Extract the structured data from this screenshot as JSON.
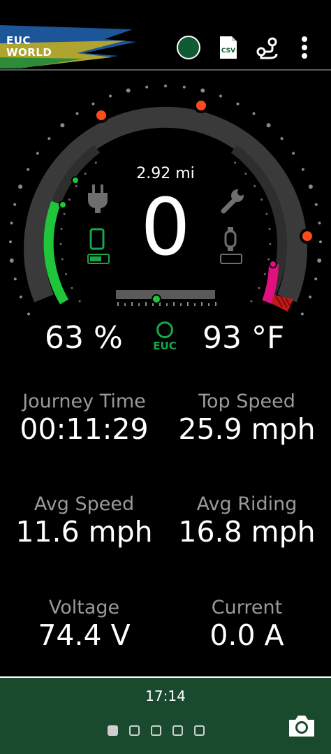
{
  "header": {
    "logo_line1": "EUC",
    "logo_line2": "WORLD",
    "csv_label": "CSV"
  },
  "gauge": {
    "distance": "2.92 mi",
    "speed": "0",
    "battery_level": 0.63,
    "battery_percent": "63 %",
    "temperature": "93 °F",
    "wheel_label": "EUC"
  },
  "stats": {
    "journey_time_label": "Journey Time",
    "journey_time_value": "00:11:29",
    "top_speed_label": "Top Speed",
    "top_speed_value": "25.9 mph",
    "avg_speed_label": "Avg Speed",
    "avg_speed_value": "11.6 mph",
    "avg_riding_label": "Avg Riding",
    "avg_riding_value": "16.8 mph",
    "voltage_label": "Voltage",
    "voltage_value": "74.4 V",
    "current_label": "Current",
    "current_value": "0.0 A"
  },
  "footer": {
    "time": "17:14",
    "pages": 5,
    "active_page": 1
  },
  "colors": {
    "accent_green": "#19a64a",
    "battery_green": "#1fc63a",
    "warning_magenta": "#e0117f",
    "marker_red": "#ff4a1a",
    "footer_bg": "#1a4a2e"
  },
  "icons": [
    "status-dot-icon",
    "csv-icon",
    "route-icon",
    "menu-icon",
    "plug-icon",
    "wrench-icon",
    "phone-battery-icon",
    "watch-battery-icon",
    "camera-icon"
  ]
}
